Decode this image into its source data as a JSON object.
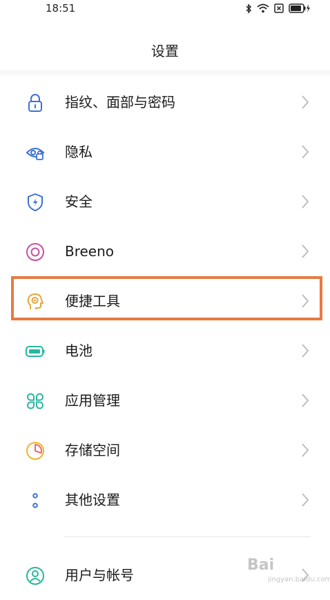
{
  "status_bar": {
    "time": "18:51",
    "icons": [
      "bluetooth-icon",
      "wifi-icon",
      "sim-x-icon",
      "battery-charging-icon"
    ]
  },
  "header": {
    "title": "设置"
  },
  "settings_items": [
    {
      "label": "指纹、面部与密码",
      "icon": "lock-icon",
      "color": "#3d6fd8"
    },
    {
      "label": "隐私",
      "icon": "privacy-eye-icon",
      "color": "#3d6fd8"
    },
    {
      "label": "安全",
      "icon": "security-shield-icon",
      "color": "#3d6fd8"
    },
    {
      "label": "Breeno",
      "icon": "breeno-icon",
      "color": "#c94f9f"
    },
    {
      "label": "便捷工具",
      "icon": "convenience-tools-icon",
      "color": "#e8a43a"
    },
    {
      "label": "电池",
      "icon": "battery-icon",
      "color": "#27b79f"
    },
    {
      "label": "应用管理",
      "icon": "app-management-icon",
      "color": "#27b79f"
    },
    {
      "label": "存储空间",
      "icon": "storage-icon",
      "color": "#f0b429"
    },
    {
      "label": "其他设置",
      "icon": "other-settings-icon",
      "color": "#3d6fd8"
    },
    {
      "label": "用户与帐号",
      "icon": "user-account-icon",
      "color": "#27b79f"
    }
  ],
  "highlight": {
    "item": "便捷工具",
    "color": "#e8793f"
  },
  "watermark": {
    "text": "Bai",
    "sub": "jingyan.baidu.com"
  }
}
